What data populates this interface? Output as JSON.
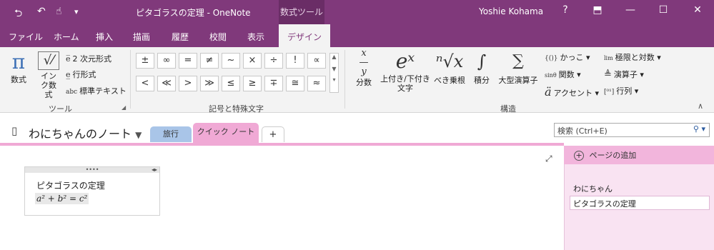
{
  "titlebar": {
    "title": "ピタゴラスの定理 - OneNote",
    "context_tab": "数式ツール",
    "user": "Yoshie Kohama",
    "help": "?",
    "restore_ribbon": "⬒",
    "minimize": "—",
    "maximize": "☐",
    "close": "✕",
    "back_icon": "⮌",
    "undo_icon": "↶",
    "touch_icon": "☝",
    "qa_more": "▾"
  },
  "tabs": [
    "ファイル",
    "ホーム",
    "挿入",
    "描画",
    "履歴",
    "校閲",
    "表示",
    "デザイン"
  ],
  "ribbon": {
    "tools": {
      "label": "ツール",
      "equation": "数式",
      "ink": "インク数式",
      "professional": "2 次元形式",
      "linear": "行形式",
      "normal_text": "標準テキスト"
    },
    "symbols": {
      "label": "記号と特殊文字",
      "row1": [
        "±",
        "∞",
        "=",
        "≠",
        "~",
        "×",
        "÷",
        "!",
        "∝"
      ],
      "row2": [
        "<",
        "≪",
        ">",
        "≫",
        "≤",
        "≥",
        "∓",
        "≅",
        "≈"
      ]
    },
    "structures": {
      "label": "構造",
      "fraction": "分数",
      "script": "上付き/下付き文字",
      "radical": "べき乗根",
      "integral": "積分",
      "large_operator": "大型演算子",
      "bracket": "かっこ",
      "function": "関数",
      "accent": "アクセント",
      "limit_log": "極限と対数",
      "operator": "演算子",
      "matrix": "行列"
    }
  },
  "notebook": {
    "name": "わにちゃんのノート",
    "sections": [
      "旅行",
      "クイック ノート"
    ],
    "add_section": "+",
    "search_placeholder": "検索 (Ctrl+E)"
  },
  "note": {
    "title": "ピタゴラスの定理",
    "equation": "a² + b² = c²"
  },
  "pages_pane": {
    "add_page": "ページの追加",
    "section_title": "わにちゃん",
    "page": "ピタゴラスの定理"
  },
  "colors": {
    "titlebar": "#80397b",
    "section_travel": "#a9c5e8",
    "section_quick": "#f0a9d5"
  }
}
